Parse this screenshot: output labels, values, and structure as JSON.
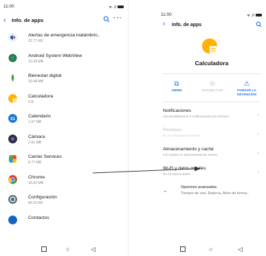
{
  "left": {
    "status": {
      "time": "11:00",
      "icons": "ᯤ.ıl"
    },
    "header": {
      "back": "‹",
      "title": "Info. de apps",
      "more": "···"
    },
    "apps": [
      {
        "name": "Alertas de emergencia inalámbric..",
        "size": "32.77 KB",
        "color": "#1565c0"
      },
      {
        "name": "Android System WebView",
        "size": "10.33 MB",
        "color": "#2e7d32"
      },
      {
        "name": "Bienestar digital",
        "size": "20.48 MB",
        "color": "#43a047"
      },
      {
        "name": "Calculadora",
        "size": "0 B",
        "color": "#ffb300"
      },
      {
        "name": "Calendario",
        "size": "1.97 MB",
        "color": "#1976d2"
      },
      {
        "name": "Cámara",
        "size": "2.91 MB",
        "color": "#263238"
      },
      {
        "name": "Carrier Services",
        "size": "8.77 MB",
        "color": "#4caf50"
      },
      {
        "name": "Chrome",
        "size": "33.82 MB",
        "color": "#e53935"
      },
      {
        "name": "Configuración",
        "size": "86.53 KB",
        "color": "#546e7a"
      },
      {
        "name": "Contactos",
        "size": "",
        "color": "#1565c0"
      }
    ],
    "calendar_day": "31",
    "nav": {
      "home": "○",
      "back": "◁"
    }
  },
  "right": {
    "status": {
      "time": "11:00",
      "icons": "ᯤ.ıl"
    },
    "header": {
      "back": "‹",
      "title": "Info. de apps"
    },
    "app_name": "Calculadora",
    "actions": [
      {
        "label": "ABRIR",
        "icon": "⧉",
        "color": "#1a73e8"
      },
      {
        "label": "INHABILITAR",
        "icon": "⊘",
        "color": "#c7c7c7"
      },
      {
        "label": "FORZAR LA DETENCIÓN",
        "icon": "⚠",
        "color": "#1a73e8"
      }
    ],
    "settings": [
      {
        "title": "Notificaciones",
        "sub": "Aproximadamente 0 notificaciones por semana",
        "disabled": false
      },
      {
        "title": "Permisos",
        "sub": "No se solicitaron permisos",
        "disabled": true
      },
      {
        "title": "Almacenamiento y caché",
        "sub": "0 B usados en almacenamiento interno",
        "disabled": false
      },
      {
        "title": "Wi-Fi y datos móviles",
        "sub": "No se usaron datos",
        "disabled": false
      }
    ],
    "advanced": {
      "title": "Opciones avanzadas",
      "sub": "Tiempo de uso, Batería, Abrir de forma.."
    },
    "nav": {
      "home": "○",
      "back": "◁"
    }
  },
  "colors": {
    "accent": "#1a73e8",
    "calculator": "#ffb300"
  }
}
